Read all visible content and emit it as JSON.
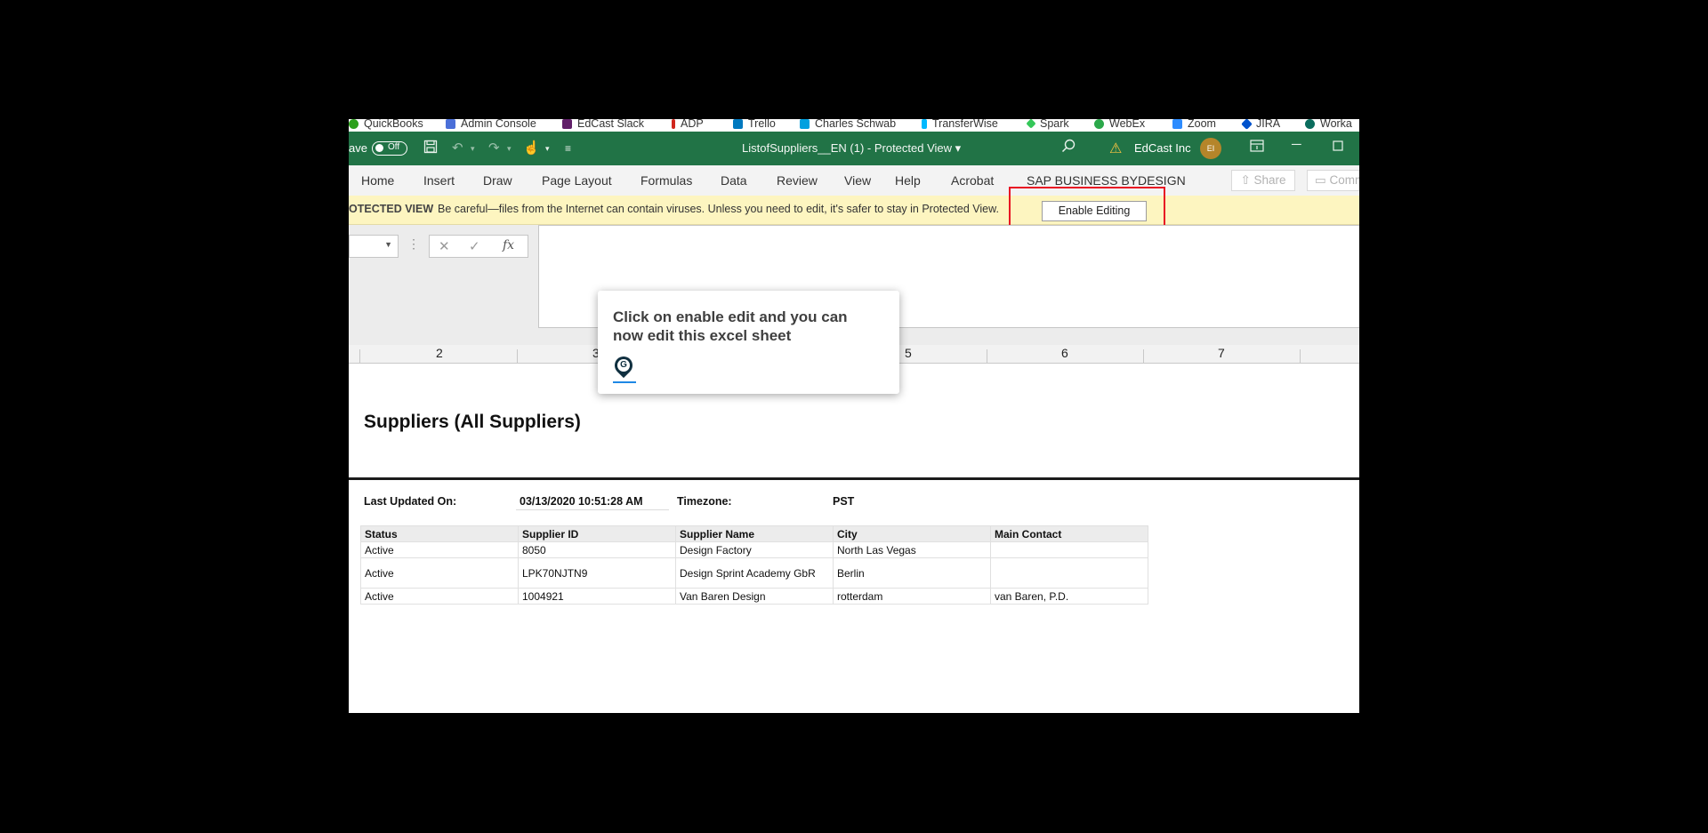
{
  "bookmarks": [
    {
      "label": "QuickBooks",
      "color": "#2ca01c"
    },
    {
      "label": "Admin Console",
      "color": "#4a6fd8"
    },
    {
      "label": "EdCast Slack",
      "color": "#611f69"
    },
    {
      "label": "ADP",
      "color": "#d0271d"
    },
    {
      "label": "Trello",
      "color": "#0079bf"
    },
    {
      "label": "Charles Schwab",
      "color": "#00a0df"
    },
    {
      "label": "TransferWise",
      "color": "#00b9ff"
    },
    {
      "label": "Spark",
      "color": "#34c759"
    },
    {
      "label": "WebEx",
      "color": "#2ba84a"
    },
    {
      "label": "Zoom",
      "color": "#2d8cff"
    },
    {
      "label": "JIRA",
      "color": "#0052cc"
    },
    {
      "label": "Worka",
      "color": "#0a6c5d"
    }
  ],
  "titlebar": {
    "autosave_prefix": "ave",
    "autosave_state": "Off",
    "doc_title": "ListofSuppliers__EN (1)  -  Protected View  ▾",
    "org_name": "EdCast Inc",
    "avatar_initials": "EI"
  },
  "menu": {
    "tabs": [
      "Home",
      "Insert",
      "Draw",
      "Page Layout",
      "Formulas",
      "Data",
      "Review",
      "View",
      "Help",
      "Acrobat",
      "SAP BUSINESS BYDESIGN"
    ],
    "share_label": "Share",
    "comments_label": "Comm"
  },
  "protected_view": {
    "label": "OTECTED VIEW",
    "message": "Be careful—files from the Internet can contain viruses. Unless you need to edit, it's safer to stay in Protected View.",
    "enable_button": "Enable Editing"
  },
  "column_headers": [
    "2",
    "3",
    "5",
    "6",
    "7"
  ],
  "sheet": {
    "title": "Suppliers (All Suppliers)",
    "last_updated_label": "Last Updated On:",
    "last_updated_value": "03/13/2020 10:51:28 AM",
    "timezone_label": "Timezone:",
    "timezone_value": "PST",
    "table": {
      "headers": [
        "Status",
        "Supplier ID",
        "Supplier Name",
        "City",
        "Main Contact"
      ],
      "rows": [
        [
          "Active",
          "8050",
          "Design Factory",
          "North Las Vegas",
          ""
        ],
        [
          "Active",
          "LPK70NJTN9",
          "Design Sprint Academy GbR",
          "Berlin",
          ""
        ],
        [
          "Active",
          "1004921",
          "Van Baren Design",
          "rotterdam",
          "van Baren, P.D."
        ]
      ]
    }
  },
  "tooltip": {
    "text": "Click on enable edit and you can now edit this excel sheet",
    "logo_letter": "G"
  }
}
